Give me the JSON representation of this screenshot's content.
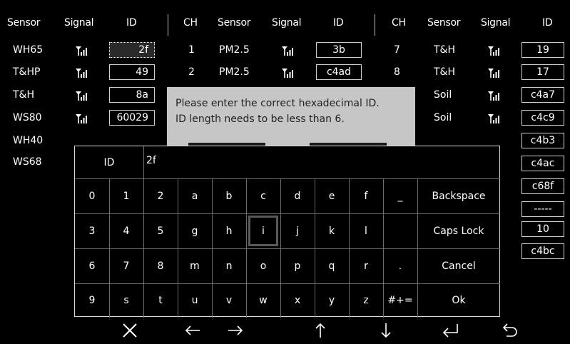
{
  "headers": {
    "left": {
      "sensor": "Sensor",
      "signal": "Signal",
      "id": "ID"
    },
    "middle": {
      "ch": "CH",
      "sensor": "Sensor",
      "signal": "Signal",
      "id": "ID"
    },
    "right": {
      "ch": "CH",
      "sensor": "Sensor",
      "signal": "Signal",
      "id": "ID"
    }
  },
  "left_rows": [
    {
      "sensor": "WH65",
      "signal": "signal-icon",
      "id": "2f"
    },
    {
      "sensor": "T&HP",
      "signal": "signal-icon",
      "id": "49"
    },
    {
      "sensor": "T&H",
      "signal": "signal-icon",
      "id": "8a"
    },
    {
      "sensor": "WS80",
      "signal": "signal-icon",
      "id": "60029"
    },
    {
      "sensor": "WH40",
      "signal": "",
      "id": ""
    },
    {
      "sensor": "WS68",
      "signal": "",
      "id": ""
    }
  ],
  "middle_rows": [
    {
      "ch": "1",
      "sensor": "PM2.5",
      "signal": "signal-icon",
      "id": "3b"
    },
    {
      "ch": "2",
      "sensor": "PM2.5",
      "signal": "signal-icon",
      "id": "c4ad"
    }
  ],
  "right_rows": [
    {
      "ch": "7",
      "sensor": "T&H",
      "signal": "signal-icon",
      "id": "19"
    },
    {
      "ch": "8",
      "sensor": "T&H",
      "signal": "signal-icon",
      "id": "17"
    },
    {
      "ch": "",
      "sensor": "Soil",
      "signal": "signal-icon",
      "id": "c4a7"
    },
    {
      "ch": "",
      "sensor": "Soil",
      "signal": "signal-icon",
      "id": "c4c9"
    },
    {
      "ch": "",
      "sensor": "",
      "signal": "",
      "id": "c4b3"
    },
    {
      "ch": "",
      "sensor": "",
      "signal": "",
      "id": "c4ac"
    },
    {
      "ch": "",
      "sensor": "",
      "signal": "",
      "id": "c68f"
    },
    {
      "ch": "",
      "sensor": "",
      "signal": "",
      "id": "-----"
    },
    {
      "ch": "",
      "sensor": "",
      "signal": "",
      "id": "10"
    },
    {
      "ch": "",
      "sensor": "",
      "signal": "",
      "id": "c4bc"
    }
  ],
  "dialog": {
    "line1": "Please enter the correct hexadecimal ID.",
    "line2": "ID length needs to be less than 6."
  },
  "keyboard": {
    "field_label": "ID",
    "field_value": "2f",
    "rows": [
      [
        "0",
        "1",
        "2",
        "a",
        "b",
        "c",
        "d",
        "e",
        "f",
        "_",
        "Backspace"
      ],
      [
        "3",
        "4",
        "5",
        "g",
        "h",
        "i",
        "j",
        "k",
        "l",
        "",
        "Caps Lock"
      ],
      [
        "6",
        "7",
        "8",
        "m",
        "n",
        "o",
        "p",
        "q",
        "r",
        ".",
        "Cancel"
      ],
      [
        "9",
        "s",
        "t",
        "u",
        "v",
        "w",
        "x",
        "y",
        "z",
        "#+=",
        "Ok"
      ]
    ],
    "highlighted": "i"
  },
  "nav": [
    {
      "name": "close-icon"
    },
    {
      "name": "arrow-left-icon"
    },
    {
      "name": "arrow-right-icon"
    },
    {
      "name": "arrow-up-icon"
    },
    {
      "name": "arrow-down-icon"
    },
    {
      "name": "enter-icon"
    },
    {
      "name": "back-icon"
    }
  ]
}
